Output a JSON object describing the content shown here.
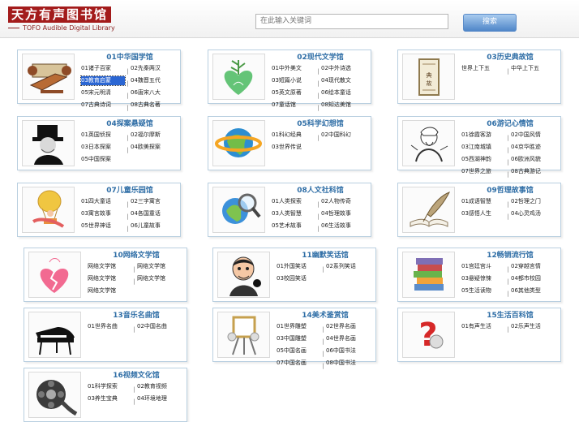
{
  "header": {
    "logo_cn": "天方有声图书馆",
    "logo_en": "TOFO Audible Digital Library",
    "search_placeholder": "在此输入关键词",
    "search_button": "搜索"
  },
  "libraries": [
    {
      "title": "01中华国学馆",
      "icon": "scroll-icon",
      "rows": [
        [
          "01诸子百家",
          "02先秦两汉"
        ],
        [
          "03教育启蒙",
          "04魏晋五代"
        ],
        [
          "05宋元明清",
          "06唐宋八大"
        ],
        [
          "07古典诗词",
          "08古典名著"
        ]
      ],
      "selected": "03教育启蒙"
    },
    {
      "title": "02现代文学馆",
      "icon": "heart-plant-icon",
      "rows": [
        [
          "01中外美文",
          "02中外诗选"
        ],
        [
          "03短篇小说",
          "04现代散文"
        ],
        [
          "05英文原著",
          "06绘本童话"
        ],
        [
          "07童话馆",
          "08知达美馆"
        ]
      ]
    },
    {
      "title": "03历史典故馆",
      "icon": "ancient-book-icon",
      "rows": [
        [
          "世界上下五",
          "中华上下五"
        ]
      ]
    },
    {
      "title": "04探案悬疑馆",
      "icon": "detective-icon",
      "rows": [
        [
          "01英国侦探",
          "02福尔摩斯"
        ],
        [
          "03日本探案",
          "04欧美探案"
        ],
        [
          "05中国探案",
          ""
        ]
      ]
    },
    {
      "title": "05科学幻想馆",
      "icon": "globe-icon",
      "rows": [
        [
          "01科幻经典",
          "02中国科幻"
        ],
        [
          "03世界传说",
          ""
        ]
      ]
    },
    {
      "title": "06游记心情馆",
      "icon": "scholar-icon",
      "rows": [
        [
          "01徐霞客游",
          "02中国风情"
        ],
        [
          "03江南城镇",
          "04京华胜迹"
        ],
        [
          "05西湖神韵",
          "06欧洲风貌"
        ],
        [
          "07世界之旅",
          "08古典游记"
        ]
      ]
    },
    {
      "title": "07儿童乐园馆",
      "icon": "balloon-icon",
      "rows": [
        [
          "01四大童话",
          "02三字寓言"
        ],
        [
          "03寓言故事",
          "04各国童话"
        ],
        [
          "05世界神话",
          "06儿童故事"
        ]
      ]
    },
    {
      "title": "08人文社科馆",
      "icon": "magnifier-globe-icon",
      "rows": [
        [
          "01人类探索",
          "02人物传奇"
        ],
        [
          "03人类智慧",
          "04哲理故事"
        ],
        [
          "05艺术故事",
          "06生活故事"
        ]
      ]
    },
    {
      "title": "09哲理故事馆",
      "icon": "quill-book-icon",
      "rows": [
        [
          "01成语智慧",
          "02哲理之门"
        ],
        [
          "03感悟人生",
          "04心灵鸡汤"
        ]
      ]
    },
    {
      "title": "10网络文学馆",
      "icon": "broken-heart-icon",
      "rows": [
        [
          "网络文学馆",
          "网络文学馆"
        ],
        [
          "网络文学馆",
          "网络文学馆"
        ],
        [
          "网络文学馆",
          ""
        ]
      ]
    },
    {
      "title": "11幽默笑话馆",
      "icon": "cartoon-man-icon",
      "rows": [
        [
          "01外国笑话",
          "02系列笑话"
        ],
        [
          "03校园笑话",
          ""
        ]
      ]
    },
    {
      "title": "12畅销流行馆",
      "icon": "book-stack-icon",
      "rows": [
        [
          "01宫廷宫斗",
          "02穿越言情"
        ],
        [
          "03悬疑惊悚",
          "04都市校园"
        ],
        [
          "05生活读物",
          "06其他类型"
        ]
      ]
    },
    {
      "title": "13音乐名曲馆",
      "icon": "piano-icon",
      "rows": [
        [
          "01世界名曲",
          "02中国名曲"
        ]
      ]
    },
    {
      "title": "14美术鉴赏馆",
      "icon": "easel-icon",
      "rows": [
        [
          "01世界雕塑",
          "02世界名画"
        ],
        [
          "03中国雕塑",
          "04世界名画"
        ],
        [
          "05中国名画",
          "06中国书法"
        ],
        [
          "07中国名画",
          "08中国书法"
        ]
      ]
    },
    {
      "title": "15生活百科馆",
      "icon": "question-mark-icon",
      "rows": [
        [
          "01有声生活",
          "02乐声生活"
        ]
      ]
    },
    {
      "title": "16视频文化馆",
      "icon": "film-reel-icon",
      "rows": [
        [
          "01科学探索",
          "02教育视频"
        ],
        [
          "03养生宝典",
          "04环境地理"
        ]
      ]
    }
  ]
}
